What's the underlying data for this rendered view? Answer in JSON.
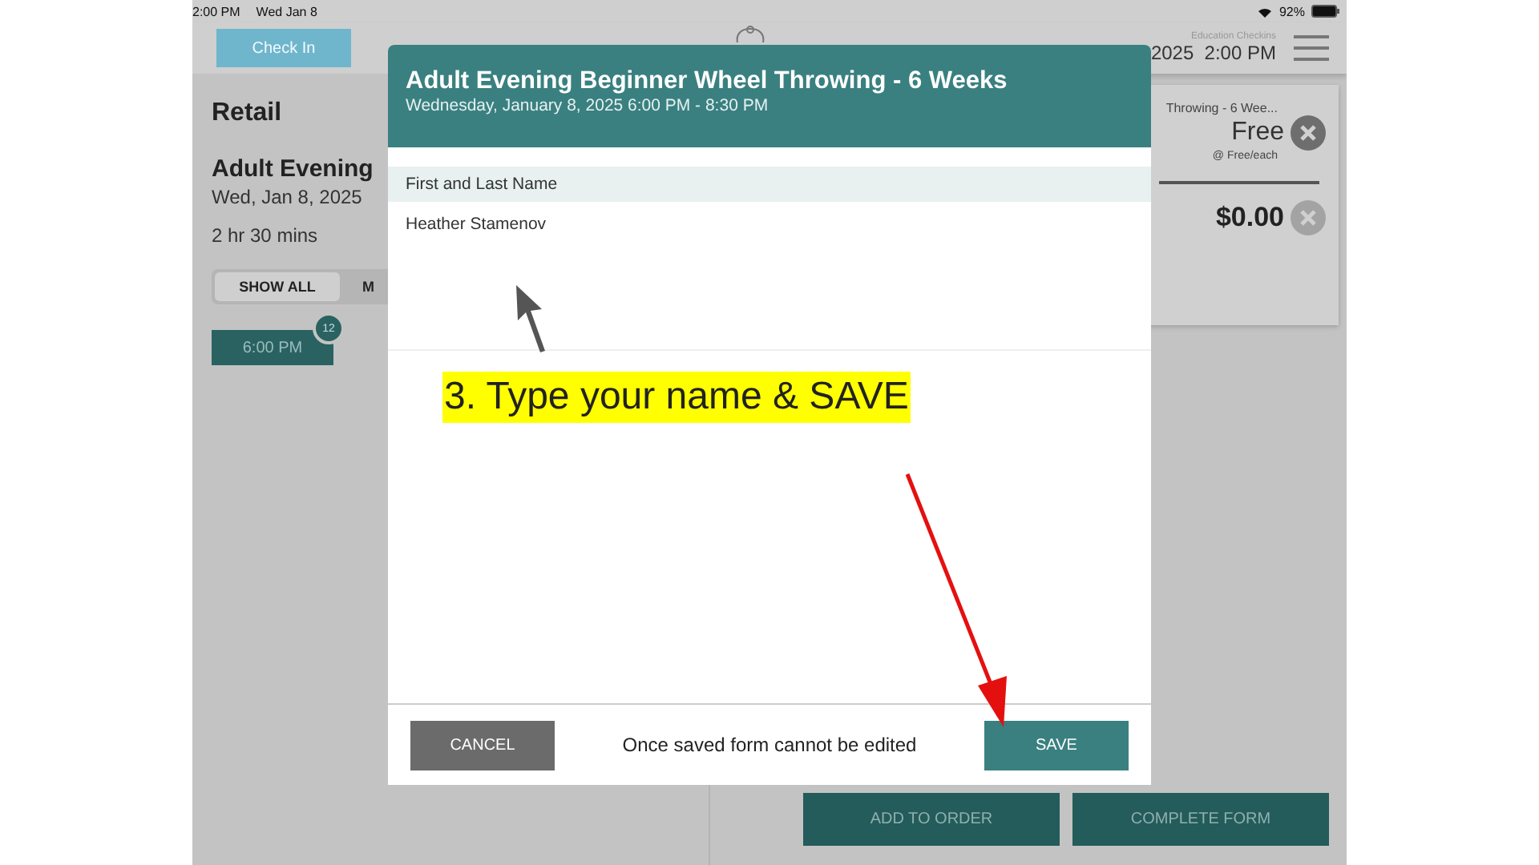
{
  "status_bar": {
    "time": "2:00 PM",
    "date": "Wed Jan 8",
    "battery": "92%"
  },
  "top_bar": {
    "check_in_button": "Check In",
    "app_name": "Education Checkins",
    "datetime": "2025  2:00 PM"
  },
  "left_panel": {
    "section": "Retail",
    "event_title": "Adult Evening",
    "event_date": "Wed, Jan 8, 2025",
    "duration": "2 hr 30 mins",
    "filters": [
      {
        "label": "SHOW ALL",
        "selected": true
      },
      {
        "label": "M",
        "selected": false
      }
    ],
    "time_slots": [
      {
        "label": "6:00 PM",
        "badge": "12",
        "selected": true
      }
    ]
  },
  "cart": {
    "item_name": "Throwing - 6 Wee...",
    "item_price": "Free",
    "unit_price": "@ Free/each",
    "total": "$0.00"
  },
  "actions": [
    "ADD TO ORDER",
    "COMPLETE FORM"
  ],
  "dialog": {
    "title": "Adult Evening Beginner Wheel Throwing - 6 Weeks",
    "subtitle": "Wednesday, January 8, 2025  6:00 PM - 8:30 PM",
    "field_label": "First and Last Name",
    "field_value": "Heather Stamenov",
    "cancel": "CANCEL",
    "note": "Once saved form cannot be edited",
    "save": "SAVE"
  },
  "annotation": {
    "text": "3. Type your name & SAVE"
  }
}
